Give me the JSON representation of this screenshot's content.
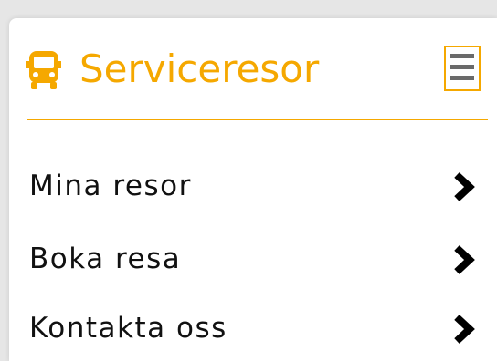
{
  "header": {
    "title": "Serviceresor",
    "logo_icon": "bus-icon",
    "menu_icon": "hamburger-menu-icon"
  },
  "nav": {
    "items": [
      {
        "label": "Mina resor",
        "icon": "chevron-right-icon"
      },
      {
        "label": "Boka resa",
        "icon": "chevron-right-icon"
      },
      {
        "label": "Kontakta oss",
        "icon": "chevron-right-icon"
      }
    ]
  },
  "colors": {
    "accent": "#f5a800",
    "text": "#111111",
    "menu_bars": "#6a6a6a",
    "background": "#e6e6e6",
    "card": "#ffffff"
  }
}
